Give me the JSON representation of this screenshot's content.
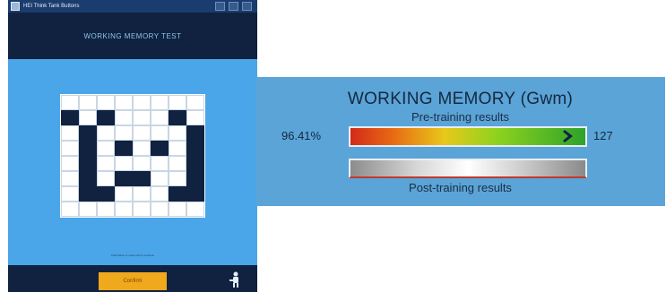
{
  "app": {
    "window_title": "HEI Think Tank Buttons",
    "heading": "WORKING MEMORY TEST",
    "grid_pattern": [
      [
        0,
        0,
        0,
        0,
        0,
        0,
        0,
        0
      ],
      [
        1,
        0,
        1,
        0,
        0,
        0,
        1,
        0
      ],
      [
        0,
        1,
        0,
        0,
        0,
        0,
        0,
        1
      ],
      [
        0,
        1,
        0,
        1,
        0,
        1,
        0,
        1
      ],
      [
        0,
        1,
        0,
        0,
        0,
        0,
        0,
        1
      ],
      [
        0,
        1,
        0,
        1,
        1,
        0,
        0,
        1
      ],
      [
        0,
        1,
        1,
        0,
        0,
        0,
        1,
        1
      ],
      [
        0,
        0,
        0,
        0,
        0,
        0,
        0,
        0
      ]
    ],
    "hint": "Click below or space bar to continue",
    "confirm_label": "Confirm"
  },
  "results": {
    "heading": "WORKING MEMORY (Gwm)",
    "pre_label": "Pre-training results",
    "percent": "96.41%",
    "score": "127",
    "pre_fill": 0.9641,
    "post_label": "Post-training results"
  },
  "colors": {
    "app_background": "#4aa6e8",
    "header_navy": "#10223f",
    "cell_dark": "#10223f",
    "cell_light": "#ffffff",
    "confirm_orange": "#f0a81c",
    "panel_blue": "#5aa4d8"
  },
  "icons": {
    "confirm_side": "person-icon",
    "bar_marker": "chevron-right-icon"
  }
}
